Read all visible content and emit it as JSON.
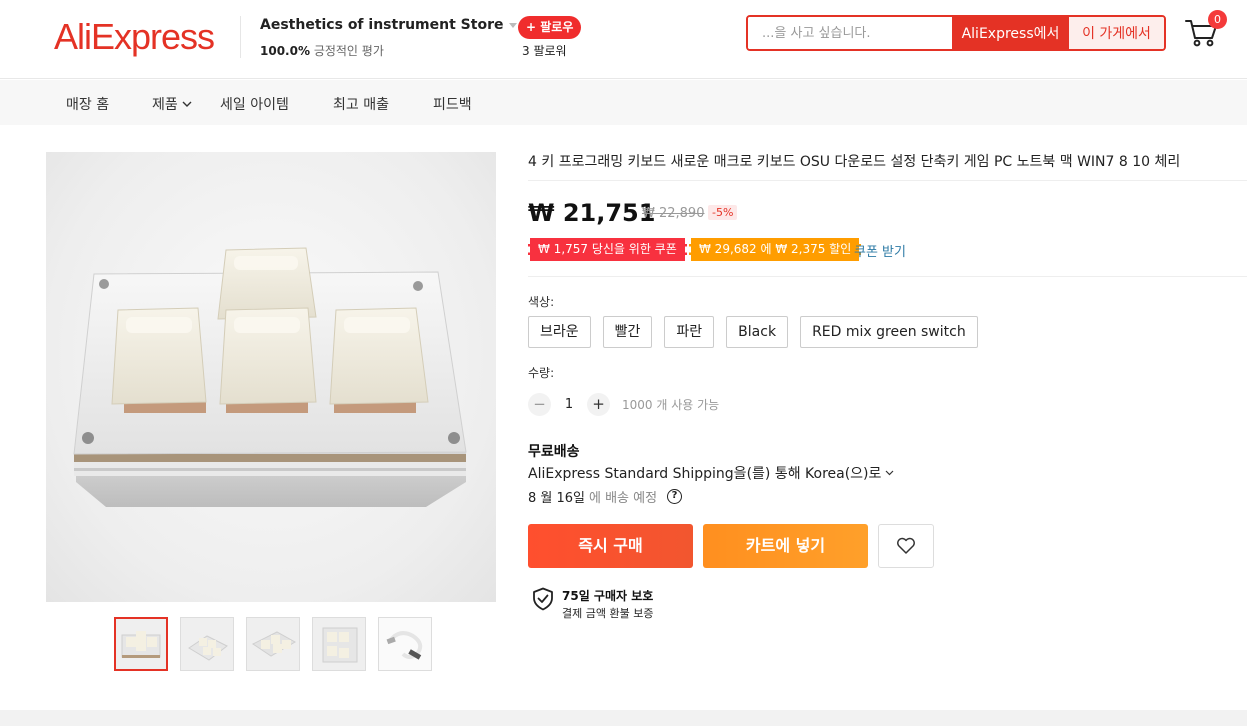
{
  "header": {
    "logo": "AliExpress",
    "store": {
      "name": "Aesthetics of instrument Store",
      "rating_value": "100.0%",
      "rating_label": "긍정적인 평가",
      "follow_label": "+ 팔로우",
      "followers": "3 팔로워"
    },
    "search": {
      "placeholder": "...을 사고 싶습니다.",
      "btn_aliexpress": "AliExpress에서",
      "btn_store": "이 가게에서"
    },
    "cart_count": "0"
  },
  "nav": {
    "items": [
      {
        "label": "매장 홈"
      },
      {
        "label": "제품"
      },
      {
        "label": "세일 아이템"
      },
      {
        "label": "최고 매출"
      },
      {
        "label": "피드백"
      }
    ]
  },
  "product": {
    "title": "4 키 프로그래밍 키보드 새로운 매크로 키보드 OSU 다운로드 설정 단축키 게임 PC 노트북 맥 WIN7 8 10 체리",
    "price": "₩ 21,751",
    "old_price": "₩ 22,890",
    "discount": "-5%",
    "coupon1": "₩ 1,757 당신을 위한 쿠폰",
    "coupon2": "₩ 29,682 에 ₩ 2,375 할인",
    "coupon_link": "쿠폰 받기",
    "color_label": "색상:",
    "colors": [
      "브라운",
      "빨간",
      "파란",
      "Black",
      "RED mix green switch"
    ],
    "qty_label": "수량:",
    "qty_minus": "−",
    "qty_value": "1",
    "qty_plus": "+",
    "qty_available": "1000 개 사용 가능",
    "shipping_title": "무료배송",
    "shipping_method": "AliExpress Standard Shipping을(를) 통해 Korea(으)로",
    "delivery_date": "8 월 16일",
    "delivery_suffix": "에 배송 예정",
    "buy_now": "즉시 구매",
    "add_to_cart": "카트에 넣기",
    "protection_title": "75일 구매자 보호",
    "protection_sub": "결제 금액 환불 보증"
  },
  "colors": {
    "brand_red": "#e43225",
    "coupon_red": "#f8313f",
    "coupon_orange": "#ff9d00",
    "link_blue": "#2e7ba6"
  }
}
